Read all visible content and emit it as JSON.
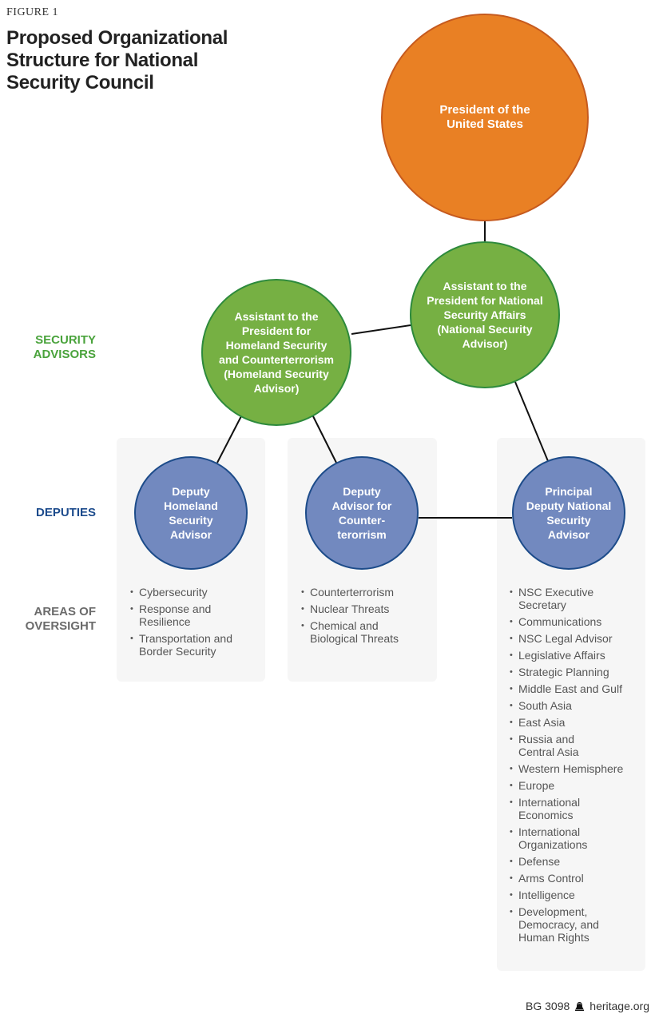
{
  "figure_label": "FIGURE 1",
  "title": "Proposed Organizational Structure for National Security Council",
  "colors": {
    "president_fill": "#e98024",
    "advisor_fill": "#76b043",
    "deputy_fill": "#7289bf",
    "panel_bg": "#f6f6f6",
    "security_label": "#4aa33c",
    "deputies_label": "#1c4b8c",
    "areas_label": "#6b6b6b"
  },
  "row_labels": {
    "security_advisors": "SECURITY\nADVISORS",
    "deputies": "DEPUTIES",
    "areas_of_oversight": "AREAS OF\nOVERSIGHT"
  },
  "nodes": {
    "president": "President of the\nUnited States",
    "national_security_advisor": "Assistant to the\nPresident for National\nSecurity Affairs\n(National Security\nAdvisor)",
    "homeland_security_advisor": "Assistant to the\nPresident for\nHomeland Security\nand Counterterrorism\n(Homeland Security\nAdvisor)",
    "deputy_homeland": "Deputy\nHomeland\nSecurity\nAdvisor",
    "deputy_counterterrorism": "Deputy\nAdvisor for\nCounter-\nterorrism",
    "principal_deputy": "Principal\nDeputy National\nSecurity\nAdvisor"
  },
  "edges": [
    [
      "president",
      "national_security_advisor"
    ],
    [
      "national_security_advisor",
      "homeland_security_advisor"
    ],
    [
      "national_security_advisor",
      "principal_deputy"
    ],
    [
      "homeland_security_advisor",
      "deputy_homeland"
    ],
    [
      "homeland_security_advisor",
      "deputy_counterterrorism"
    ],
    [
      "deputy_counterterrorism",
      "principal_deputy"
    ]
  ],
  "oversight": {
    "deputy_homeland": [
      "Cybersecurity",
      "Response and\nResilience",
      "Transportation and\nBorder Security"
    ],
    "deputy_counterterrorism": [
      "Counterterrorism",
      "Nuclear Threats",
      "Chemical and\nBiological Threats"
    ],
    "principal_deputy": [
      "NSC Executive\nSecretary",
      "Communications",
      "NSC Legal Advisor",
      "Legislative Affairs",
      "Strategic Planning",
      "Middle East and Gulf",
      "South Asia",
      "East Asia",
      "Russia and\nCentral Asia",
      "Western Hemisphere",
      "Europe",
      "International\nEconomics",
      "International\nOrganizations",
      "Defense",
      "Arms Control",
      "Intelligence",
      "Development,\nDemocracy, and\nHuman Rights"
    ]
  },
  "footer": {
    "report_id": "BG 3098",
    "logo_icon": "liberty-bell-icon",
    "site": "heritage.org"
  }
}
